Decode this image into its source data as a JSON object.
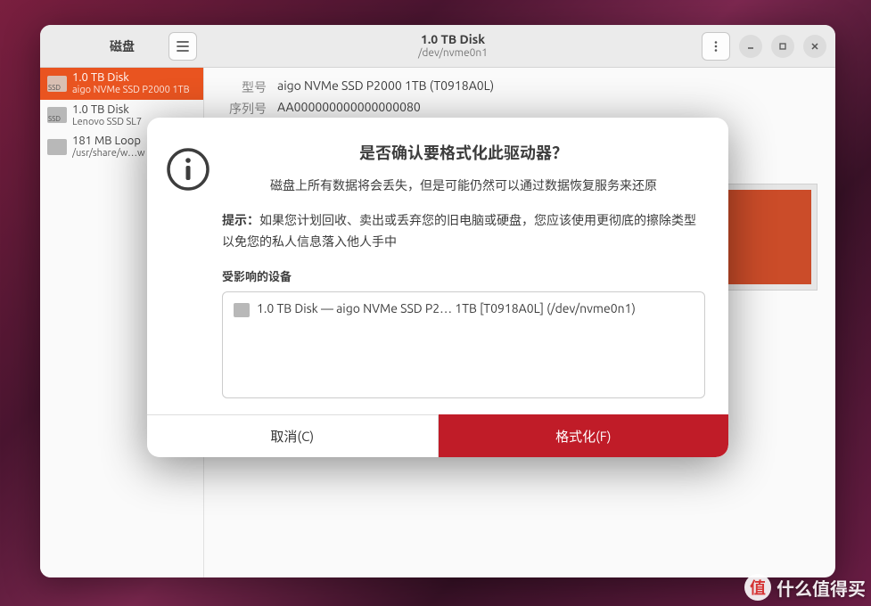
{
  "header": {
    "app_title": "磁盘",
    "disk_title": "1.0 TB Disk",
    "disk_path": "/dev/nvme0n1"
  },
  "sidebar": {
    "items": [
      {
        "title": "1.0 TB Disk",
        "subtitle": "aigo NVMe SSD P2000 1TB",
        "icon_label": "SSD",
        "selected": true
      },
      {
        "title": "1.0 TB Disk",
        "subtitle": "Lenovo SSD SL7",
        "icon_label": "SSD",
        "selected": false
      },
      {
        "title": "181 MB Loop",
        "subtitle": "/usr/share/w…w",
        "icon_label": "",
        "selected": false
      }
    ]
  },
  "details": {
    "model_label": "型号",
    "model_value": "aigo NVMe SSD P2000 1TB (T0918A0L)",
    "serial_label": "序列号",
    "serial_value": "AA000000000000000080"
  },
  "dialog": {
    "title": "是否确认要格式化此驱动器？",
    "message": "磁盘上所有数据将会丢失，但是可能仍然可以通过数据恢复服务来还原",
    "hint_label": "提示：",
    "hint_text": "如果您计划回收、卖出或丢弃您的旧电脑或硬盘，您应该使用更彻底的擦除类型以免您的私人信息落入他人手中",
    "affected_label": "受影响的设备",
    "affected_device": "1.0 TB Disk — aigo NVMe SSD P2… 1TB [T0918A0L] (/dev/nvme0n1)",
    "cancel_label": "取消(C)",
    "confirm_label": "格式化(F)"
  },
  "watermark": {
    "badge": "值",
    "text": "什么值得买"
  }
}
